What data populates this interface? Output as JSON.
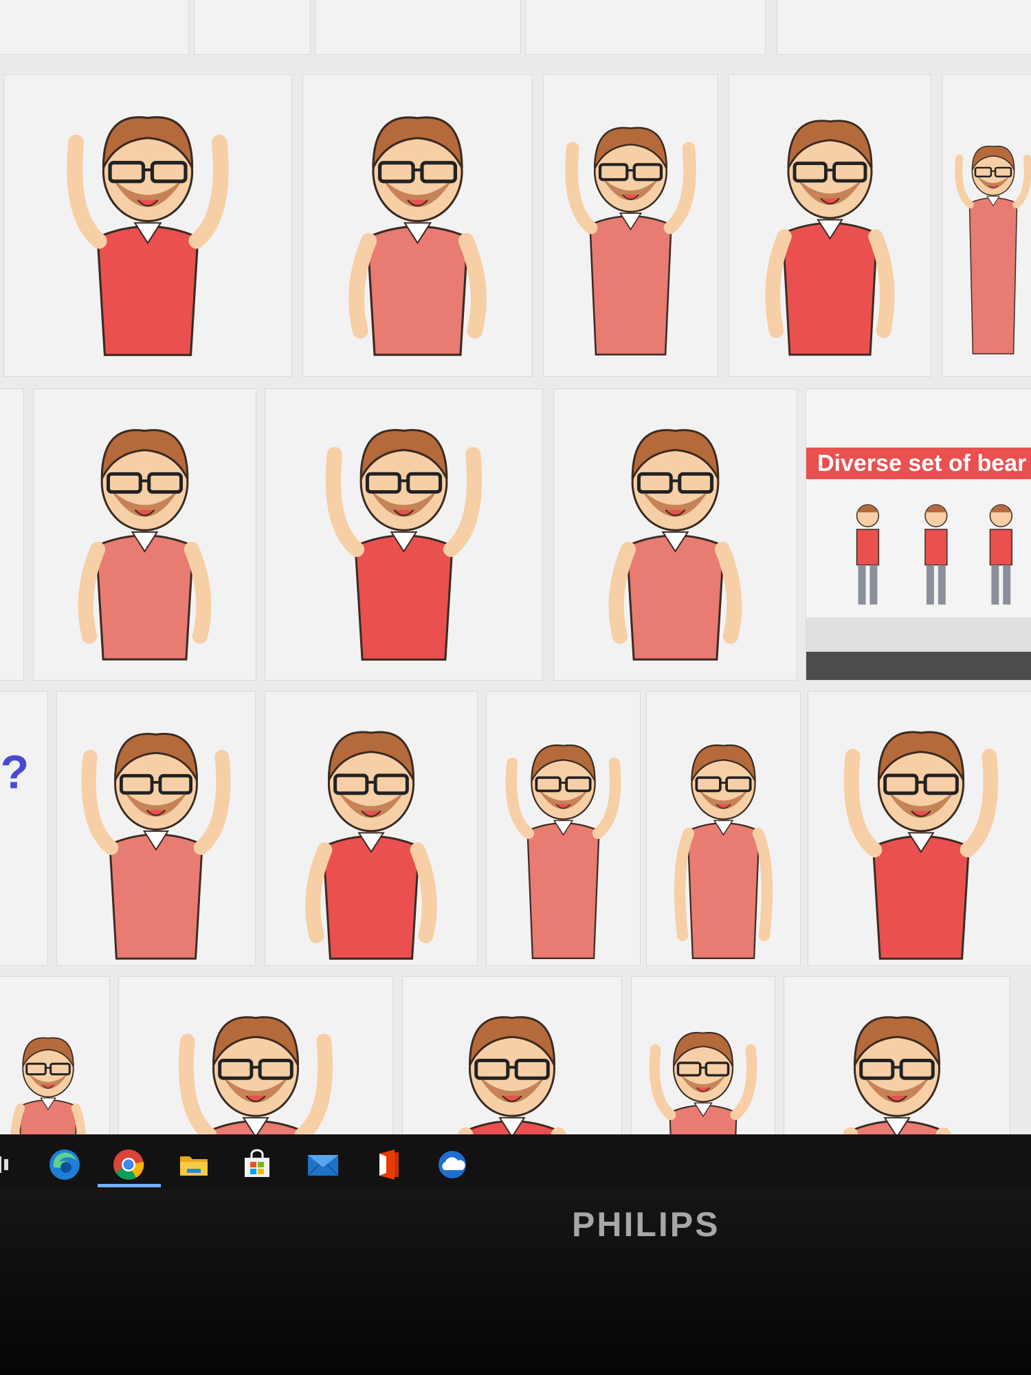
{
  "preview_banner": "Diverse set of bear",
  "bezel_brand": "PHILIPS",
  "taskbar": {
    "icons": [
      "task-view-icon",
      "edge-icon",
      "chrome-icon",
      "file-explorer-icon",
      "store-icon",
      "mail-icon",
      "office-icon",
      "onedrive-icon"
    ],
    "active": "chrome-icon"
  },
  "colors": {
    "shirt": "#e9504f",
    "shirt_light": "#e87b72",
    "hair": "#b56a3c",
    "skin": "#f6cfa6",
    "accent_yellow": "#f5c518",
    "taskbar": "#121212",
    "active_indicator": "#6fb4ff"
  }
}
